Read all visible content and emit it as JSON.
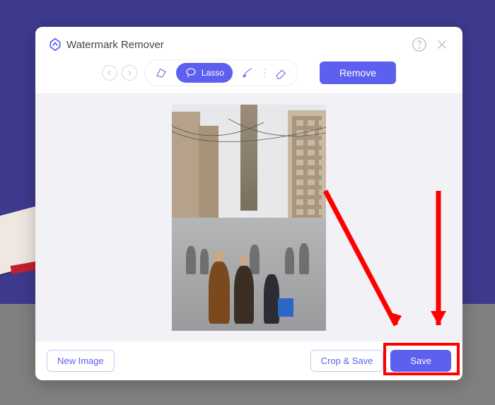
{
  "header": {
    "title": "Watermark Remover"
  },
  "toolbar": {
    "lasso_label": "Lasso",
    "remove_label": "Remove"
  },
  "footer": {
    "new_image_label": "New Image",
    "crop_save_label": "Crop & Save",
    "save_label": "Save"
  },
  "colors": {
    "accent": "#5d5fef",
    "highlight": "#ff0000"
  }
}
